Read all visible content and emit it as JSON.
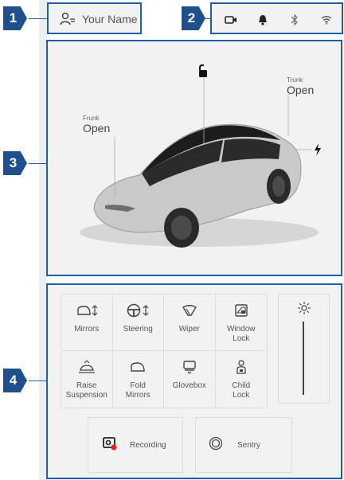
{
  "callouts": [
    "1",
    "2",
    "3",
    "4"
  ],
  "profile": {
    "name": "Your Name",
    "icon": "user-icon"
  },
  "status_icons": [
    "camera-icon",
    "bell-icon",
    "bluetooth-icon",
    "wifi-icon"
  ],
  "car": {
    "lock_icon": "unlock-icon",
    "frunk": {
      "title": "Frunk",
      "state": "Open"
    },
    "trunk": {
      "title": "Trunk",
      "state": "Open"
    },
    "charge_icon": "lightning-icon"
  },
  "controls": {
    "tiles": [
      {
        "label": "Mirrors",
        "icon": "mirror-adjust-icon"
      },
      {
        "label": "Steering",
        "icon": "steering-wheel-icon"
      },
      {
        "label": "Wiper",
        "icon": "wiper-icon"
      },
      {
        "label": "Window\nLock",
        "icon": "window-lock-icon"
      },
      {
        "label": "Raise\nSuspension",
        "icon": "suspension-icon"
      },
      {
        "label": "Fold\nMirrors",
        "icon": "fold-mirror-icon"
      },
      {
        "label": "Glovebox",
        "icon": "glovebox-icon"
      },
      {
        "label": "Child\nLock",
        "icon": "child-lock-icon"
      }
    ],
    "brightness_icon": "brightness-icon",
    "recording": {
      "label": "Recording",
      "icon": "dashcam-record-icon",
      "indicator_color": "#e02424"
    },
    "sentry": {
      "label": "Sentry",
      "icon": "sentry-icon"
    }
  },
  "colors": {
    "callout": "#1f4f8c",
    "outline": "#1f5fa6",
    "panel": "#f2f2f2"
  }
}
